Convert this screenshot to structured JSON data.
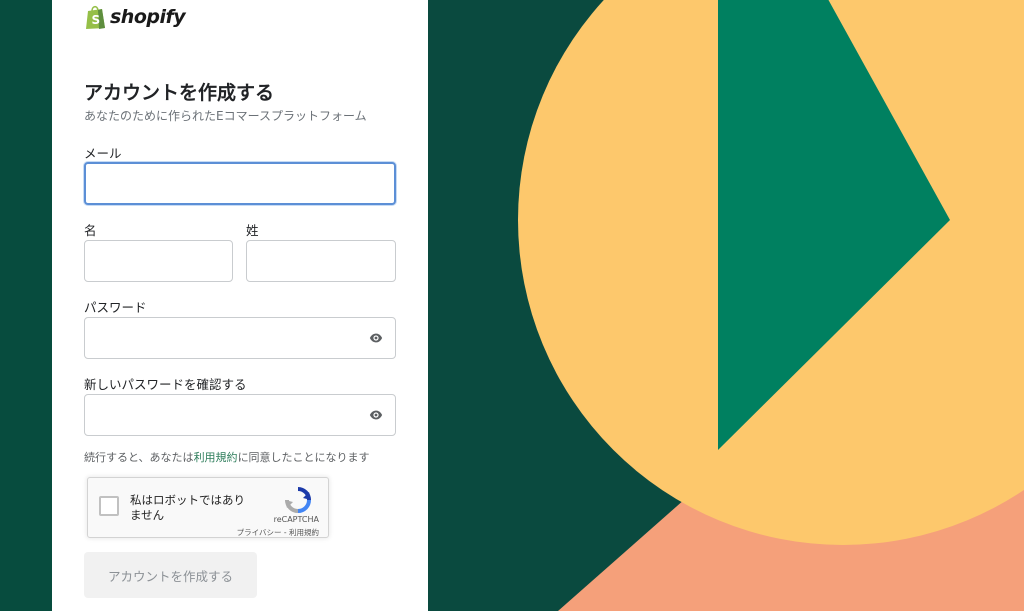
{
  "brand": {
    "name": "shopify",
    "icon": "shopify-bag-icon"
  },
  "form": {
    "title": "アカウントを作成する",
    "subtitle": "あなたのために作られたEコマースプラットフォーム",
    "email_label": "メール",
    "email_value": "",
    "first_name_label": "名",
    "first_name_value": "",
    "last_name_label": "姓",
    "last_name_value": "",
    "password_label": "パスワード",
    "password_value": "",
    "confirm_password_label": "新しいパスワードを確認する",
    "confirm_password_value": "",
    "show_password_icon": "eye-icon",
    "terms_prefix": "続行すると、あなたは",
    "terms_link": "利用規約",
    "terms_suffix": "に同意したことになります",
    "submit_label": "アカウントを作成する"
  },
  "captcha": {
    "checkbox_label": "私はロボットではありません",
    "brand": "reCAPTCHA",
    "privacy": "プライバシー",
    "separator": " - ",
    "terms": "利用規約",
    "checked": false
  },
  "colors": {
    "dark_green": "#074c3e",
    "green": "#008060",
    "yellow": "#ffc96b",
    "salmon": "#f5a07a",
    "focus_blue": "#5c8fd6",
    "link_green": "#2e7d5b"
  }
}
